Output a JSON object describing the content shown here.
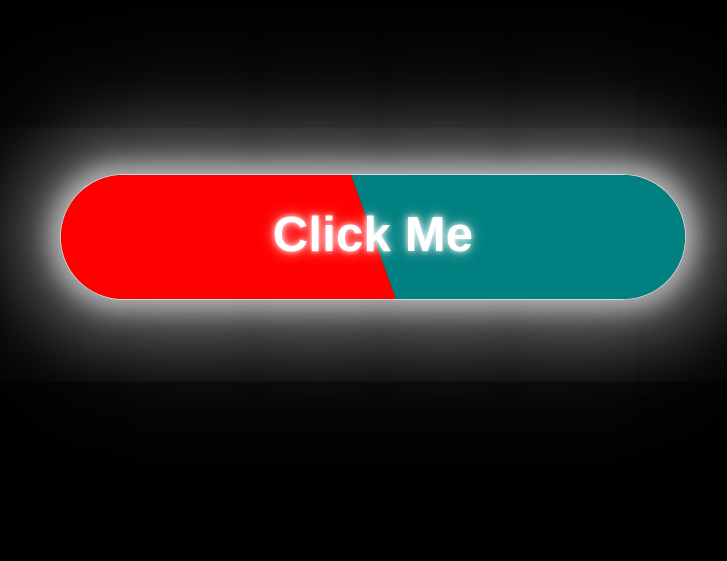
{
  "button": {
    "label": "Click Me",
    "colors": {
      "left": "#ff0000",
      "right": "#008080",
      "text": "#ffffff",
      "border": "#ffffff",
      "background": "#000000"
    }
  }
}
